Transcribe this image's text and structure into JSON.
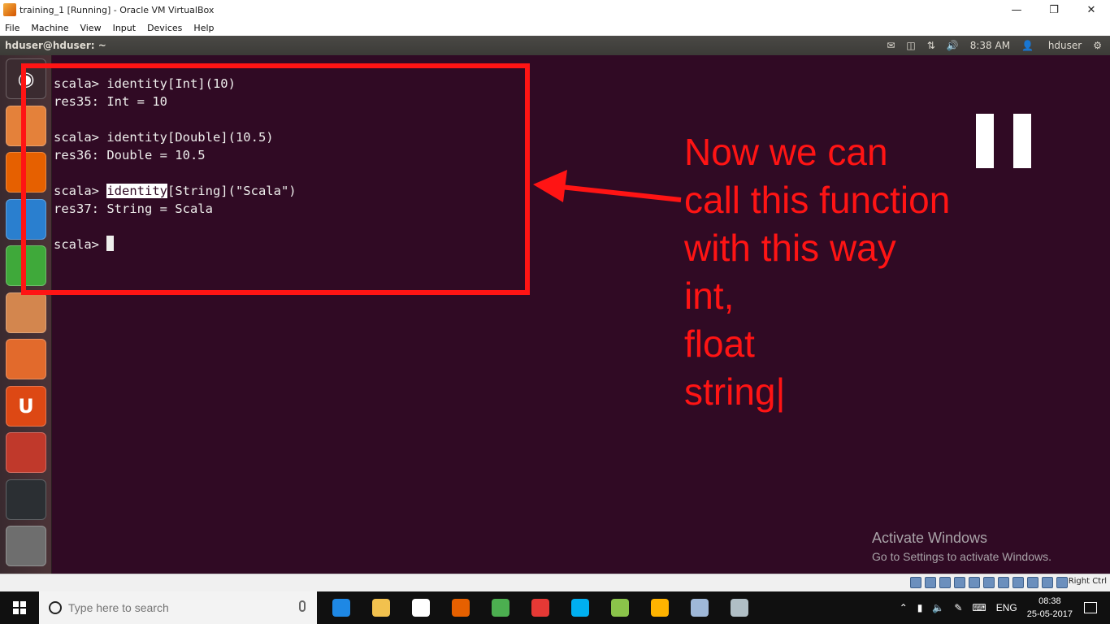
{
  "window": {
    "title": "training_1 [Running] - Oracle VM VirtualBox",
    "menu": [
      "File",
      "Machine",
      "View",
      "Input",
      "Devices",
      "Help"
    ]
  },
  "guest": {
    "panel_title": "hduser@hduser: ~",
    "indicators": {
      "mail": "mail-icon",
      "battery": "battery-icon",
      "network": "network-icon",
      "volume": "volume-icon",
      "time": "8:38 AM",
      "user": "hduser",
      "settings": "gear-icon"
    },
    "launcher": [
      {
        "name": "launcher-dash",
        "glyph": "◉",
        "color": "#3b2b30"
      },
      {
        "name": "launcher-files",
        "glyph": "",
        "color": "#e4813a"
      },
      {
        "name": "launcher-firefox",
        "glyph": "",
        "color": "#e66000"
      },
      {
        "name": "launcher-writer",
        "glyph": "",
        "color": "#2a7fcf"
      },
      {
        "name": "launcher-calc",
        "glyph": "",
        "color": "#3fa93a"
      },
      {
        "name": "launcher-impress",
        "glyph": "",
        "color": "#d3864e"
      },
      {
        "name": "launcher-software",
        "glyph": "",
        "color": "#e26a2c"
      },
      {
        "name": "launcher-ubuntu-one",
        "glyph": "U",
        "color": "#dd4814"
      },
      {
        "name": "launcher-settings",
        "glyph": "",
        "color": "#c0392b"
      },
      {
        "name": "launcher-terminal",
        "glyph": "",
        "color": "#2b2f33"
      },
      {
        "name": "launcher-trash",
        "glyph": "",
        "color": "#6e6e6e"
      }
    ]
  },
  "terminal": {
    "lines": [
      {
        "prompt": "scala> ",
        "text": "identity[Int](10)"
      },
      {
        "text": "res35: Int = 10"
      },
      {
        "text": ""
      },
      {
        "prompt": "scala> ",
        "text": "identity[Double](10.5)"
      },
      {
        "text": "res36: Double = 10.5"
      },
      {
        "text": ""
      },
      {
        "prompt": "scala> ",
        "highlight": "identity",
        "text": "[String](\"Scala\")"
      },
      {
        "text": "res37: String = Scala"
      },
      {
        "text": ""
      },
      {
        "prompt": "scala> ",
        "text": "",
        "cursor": true
      }
    ]
  },
  "annotation": {
    "lines": [
      "Now we can",
      "call this function",
      "with this way",
      "int,",
      "float",
      "string|"
    ],
    "color": "#ff1414"
  },
  "watermark": {
    "title": "Activate Windows",
    "subtitle": "Go to Settings to activate Windows."
  },
  "vbox_status": {
    "host_key": "Right Ctrl"
  },
  "taskbar": {
    "search_placeholder": "Type here to search",
    "apps": [
      {
        "name": "edge-icon",
        "color": "#1e88e5"
      },
      {
        "name": "file-explorer-icon",
        "color": "#f2c14e"
      },
      {
        "name": "store-icon",
        "color": "#ffffff"
      },
      {
        "name": "firefox-icon",
        "color": "#e66000"
      },
      {
        "name": "chrome-icon",
        "color": "#4caf50"
      },
      {
        "name": "screen-recorder-icon",
        "color": "#e53935"
      },
      {
        "name": "skype-icon",
        "color": "#00aff0"
      },
      {
        "name": "notepad-icon",
        "color": "#8bc34a"
      },
      {
        "name": "puzzle-icon",
        "color": "#ffb300"
      },
      {
        "name": "virtualbox-icon",
        "color": "#9fb8d8"
      },
      {
        "name": "paint-icon",
        "color": "#b0bec5"
      }
    ],
    "tray": {
      "language": "ENG",
      "time": "08:38",
      "date": "25-05-2017"
    }
  }
}
